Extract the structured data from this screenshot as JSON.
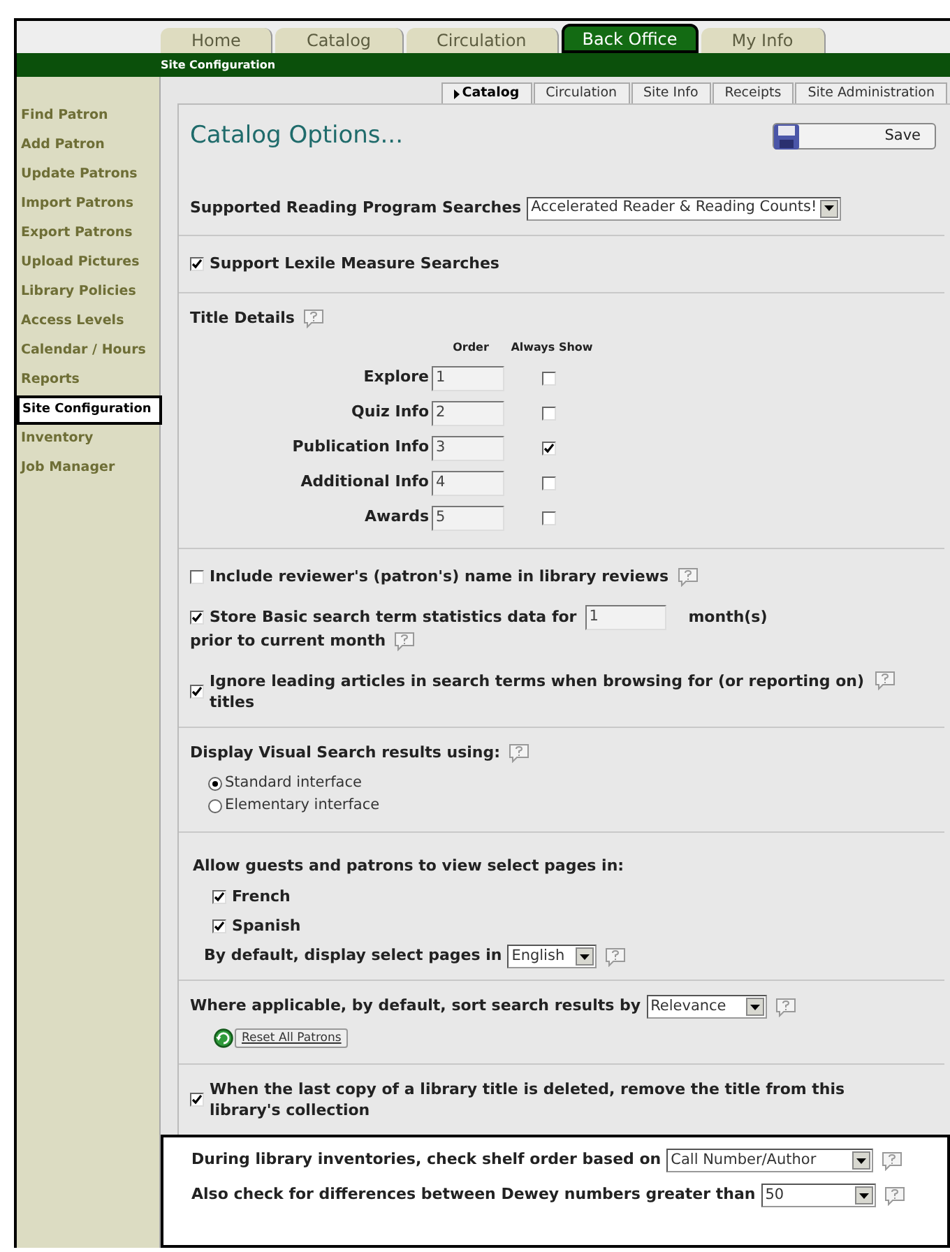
{
  "main_tabs": [
    {
      "label": "Home",
      "selected": false
    },
    {
      "label": "Catalog",
      "selected": false
    },
    {
      "label": "Circulation",
      "selected": false
    },
    {
      "label": "Back Office",
      "selected": true
    },
    {
      "label": "My Info",
      "selected": false
    }
  ],
  "breadcrumb": "Site Configuration",
  "sidebar": {
    "items": [
      {
        "label": "Find Patron",
        "selected": false
      },
      {
        "label": "Add Patron",
        "selected": false
      },
      {
        "label": "Update Patrons",
        "selected": false
      },
      {
        "label": "Import Patrons",
        "selected": false
      },
      {
        "label": "Export Patrons",
        "selected": false
      },
      {
        "label": "Upload Pictures",
        "selected": false
      },
      {
        "label": "Library Policies",
        "selected": false
      },
      {
        "label": "Access Levels",
        "selected": false
      },
      {
        "label": "Calendar / Hours",
        "selected": false
      },
      {
        "label": "Reports",
        "selected": false
      },
      {
        "label": "Site Configuration",
        "selected": true
      },
      {
        "label": "Inventory",
        "selected": false
      },
      {
        "label": "Job Manager",
        "selected": false
      }
    ]
  },
  "sub_tabs": [
    {
      "label": "Catalog",
      "selected": true
    },
    {
      "label": "Circulation",
      "selected": false
    },
    {
      "label": "Site Info",
      "selected": false
    },
    {
      "label": "Receipts",
      "selected": false
    },
    {
      "label": "Site Administration",
      "selected": false
    }
  ],
  "page_title": "Catalog Options...",
  "save_button": "Save",
  "reading_program": {
    "label": "Supported Reading Program Searches",
    "value": "Accelerated Reader & Reading Counts!"
  },
  "lexile": {
    "label": "Support Lexile Measure Searches",
    "checked": true
  },
  "title_details": {
    "label": "Title Details",
    "help": true,
    "columns": [
      "Order",
      "Always Show"
    ],
    "rows": [
      {
        "label": "Explore",
        "order": "1",
        "always_show": false
      },
      {
        "label": "Quiz Info",
        "order": "2",
        "always_show": false
      },
      {
        "label": "Publication Info",
        "order": "3",
        "always_show": true
      },
      {
        "label": "Additional Info",
        "order": "4",
        "always_show": false
      },
      {
        "label": "Awards",
        "order": "5",
        "always_show": false
      }
    ]
  },
  "reviewer_names": {
    "label": "Include reviewer's (patron's) name in library reviews",
    "checked": false,
    "help": true
  },
  "search_stats": {
    "label": "Store Basic search term statistics data for",
    "months": "1",
    "unit": "month(s)",
    "label_end": "prior to current month",
    "checked": true,
    "help": true
  },
  "ignore_articles": {
    "label": "Ignore leading articles in search terms when browsing for (or reporting on) titles",
    "checked": true,
    "help": true
  },
  "visual_search": {
    "label": "Display Visual Search results using:",
    "help": true,
    "options": [
      {
        "label": "Standard interface",
        "selected": true
      },
      {
        "label": "Elementary interface",
        "selected": false
      }
    ]
  },
  "languages": {
    "label": "Allow guests and patrons to view select pages in:",
    "options": [
      {
        "label": "French",
        "checked": true
      },
      {
        "label": "Spanish",
        "checked": true
      }
    ],
    "default_label": "By default, display select pages in",
    "default_value": "English",
    "help": true
  },
  "sort": {
    "label": "Where applicable, by default, sort search results by",
    "value": "Relevance",
    "help": true
  },
  "reset_button": "Reset All Patrons",
  "delete_title": {
    "label": "When the last copy of a library title is deleted, remove the title from this library's collection",
    "checked": true
  },
  "inventory": [
    {
      "label": "During library inventories, check shelf order based on",
      "value": "Call Number/Author",
      "help": true
    },
    {
      "label": "Also check for differences between Dewey numbers greater than",
      "value": "50",
      "help": true
    }
  ]
}
